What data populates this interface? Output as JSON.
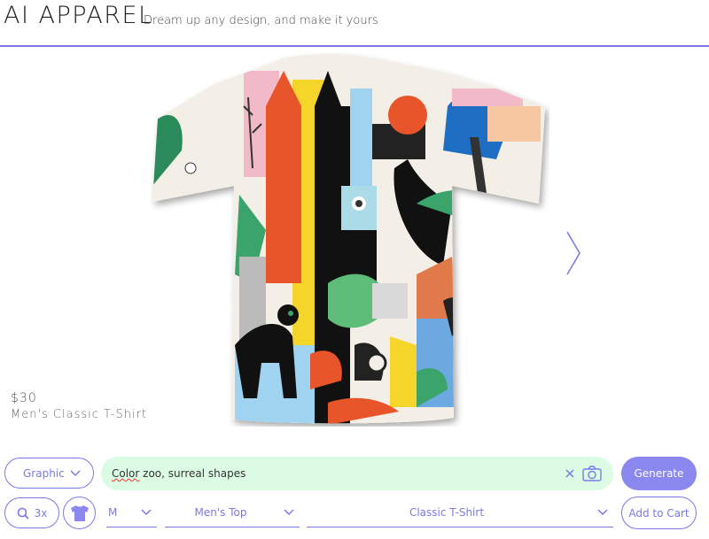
{
  "header": {
    "brand": "AI APPAREL",
    "tagline": "Dream up any design, and make it yours"
  },
  "colors": {
    "accent": "#7b79e8",
    "generate_button": "#8a87ee",
    "prompt_background": "#dcfbe4"
  },
  "preview": {
    "image_description": "T-shirt printed with colorful surreal zoo artwork",
    "next_icon": "chevron-right-icon"
  },
  "product": {
    "price": "$30",
    "name": "Men's Classic T-Shirt"
  },
  "controls": {
    "style_select": {
      "value": "Graphic",
      "icon": "chevron-down-icon"
    },
    "prompt": {
      "text_underlined": "Color",
      "text_rest": " zoo, surreal shapes",
      "clear_icon": "close-icon",
      "camera_icon": "camera-icon"
    },
    "generate_label": "Generate",
    "zoom_label": "3x",
    "zoom_icon": "search-icon",
    "shirt_icon": "tshirt-icon",
    "size_select": {
      "value": "M"
    },
    "category_select": {
      "value": "Men's Top"
    },
    "type_select": {
      "value": "Classic T-Shirt"
    },
    "add_to_cart_label": "Add to Cart"
  }
}
